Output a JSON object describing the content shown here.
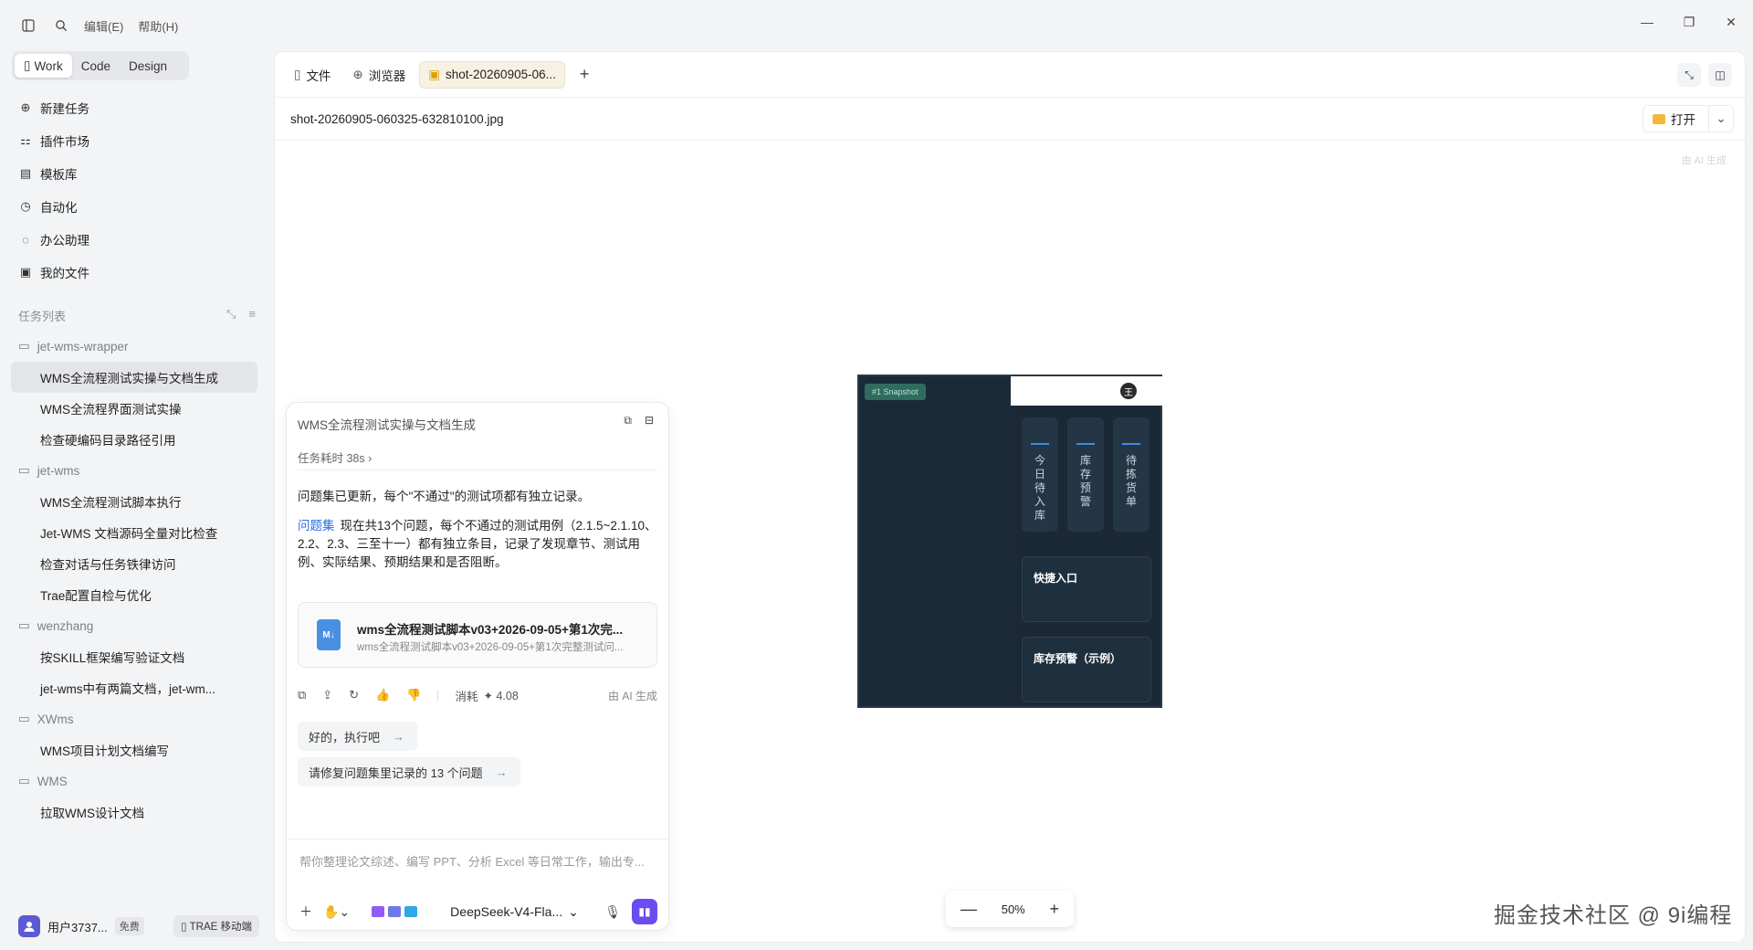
{
  "menu": {
    "edit": "编辑(E)",
    "help": "帮助(H)"
  },
  "modes": [
    "Work",
    "Code",
    "Design"
  ],
  "nav": [
    {
      "label": "新建任务",
      "icon": "plus-circle-icon",
      "glyph": "⊕"
    },
    {
      "label": "插件市场",
      "icon": "plugin-icon",
      "glyph": "⚏"
    },
    {
      "label": "模板库",
      "icon": "template-icon",
      "glyph": "▤"
    },
    {
      "label": "自动化",
      "icon": "clock-icon",
      "glyph": "◷"
    },
    {
      "label": "办公助理",
      "icon": "chat-icon",
      "glyph": "◌"
    },
    {
      "label": "我的文件",
      "icon": "files-icon",
      "glyph": "▣"
    }
  ],
  "task_list": {
    "title": "任务列表",
    "groups": [
      {
        "name": "jet-wms-wrapper",
        "tasks": [
          "WMS全流程测试实操与文档生成",
          "WMS全流程界面测试实操",
          "检查硬编码目录路径引用"
        ]
      },
      {
        "name": "jet-wms",
        "tasks": [
          "WMS全流程测试脚本执行",
          "Jet-WMS 文档源码全量对比检查",
          "检查对话与任务铁律访问",
          "Trae配置自检与优化"
        ]
      },
      {
        "name": "wenzhang",
        "tasks": [
          "按SKILL框架编写验证文档",
          "jet-wms中有两篇文档，jet-wm..."
        ]
      },
      {
        "name": "XWms",
        "tasks": [
          "WMS项目计划文档编写"
        ]
      },
      {
        "name": "WMS",
        "tasks": [
          "拉取WMS设计文档"
        ]
      }
    ]
  },
  "user": {
    "name": "用户3737...",
    "plan": "免费",
    "mobile": "TRAE 移动端"
  },
  "tabs": [
    {
      "label": "文件",
      "icon": "file-icon"
    },
    {
      "label": "浏览器",
      "icon": "globe-icon"
    },
    {
      "label": "shot-20260905-06...",
      "icon": "image-icon"
    }
  ],
  "file": {
    "name": "shot-20260905-060325-632810100.jpg",
    "open_label": "打开",
    "ai_mark": "由 AI 生成"
  },
  "preview": {
    "snapshot_label": "#1 Snapshot",
    "avatar": "王",
    "columns": [
      "今日待入库",
      "库存预警",
      "待拣货单"
    ],
    "quick_entry": "快捷入口",
    "stock_warning": "库存预警（示例）"
  },
  "zoom": {
    "level": "50%"
  },
  "watermark": "掘金技术社区 @ 9i编程",
  "chat": {
    "title": "WMS全流程测试实操与文档生成",
    "elapsed": "任务耗时 38s",
    "message1": "问题集已更新，每个\"不通过\"的测试项都有独立记录。",
    "link": "问题集",
    "message2": "现在共13个问题，每个不通过的测试用例（2.1.5~2.1.10、2.2、2.3、三至十一）都有独立条目，记录了发现章节、测试用例、实际结果、预期结果和是否阻断。",
    "file_card": {
      "title": "wms全流程测试脚本v03+2026-09-05+第1次完...",
      "subtitle": "wms全流程测试脚本v03+2026-09-05+第1次完整测试问..."
    },
    "cost_label": "消耗",
    "cost_value": "4.08",
    "ai_generated": "由 AI 生成",
    "suggestions": [
      "好的，执行吧",
      "请修复问题集里记录的 13 个问题"
    ],
    "input_placeholder": "帮你整理论文综述、编写 PPT、分析 Excel 等日常工作，输出专...",
    "model": "DeepSeek-V4-Fla..."
  },
  "colors": {
    "accent": "#6b4cf0",
    "link": "#2b6de3",
    "preview_bg": "#1b2836"
  }
}
